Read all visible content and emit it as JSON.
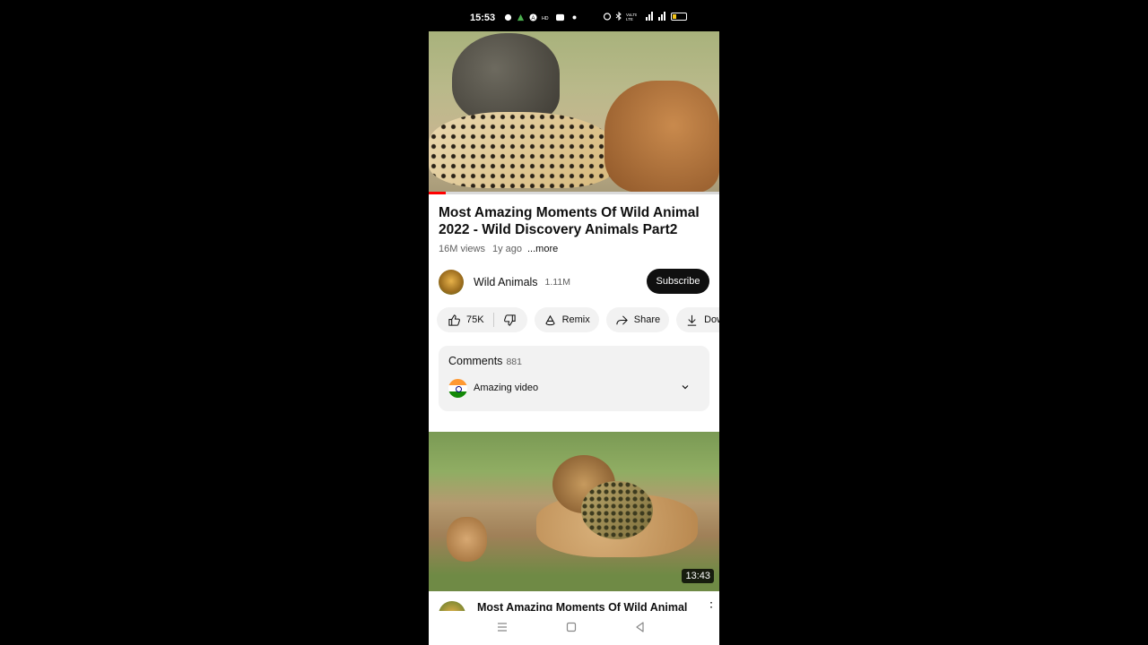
{
  "status_bar": {
    "time": "15:53"
  },
  "video": {
    "title": "Most Amazing Moments Of Wild Animal 2022 - Wild Discovery Animals Part2",
    "views": "16M views",
    "age": "1y ago",
    "more_label": "...more",
    "progress_fraction": 0.06
  },
  "channel": {
    "name": "Wild Animals",
    "subscribers": "1.11M",
    "subscribe_label": "Subscribe"
  },
  "actions": {
    "likes": "75K",
    "remix": "Remix",
    "share": "Share",
    "download": "Down"
  },
  "comments": {
    "header": "Comments",
    "count": "881",
    "top_comment": "Amazing video"
  },
  "next_video": {
    "duration": "13:43",
    "title": "Most Amazing Moments Of Wild Animal"
  },
  "colors": {
    "accent": "#ff0000",
    "button_dark": "#0f0f0f",
    "pill_bg": "#f2f2f2"
  }
}
